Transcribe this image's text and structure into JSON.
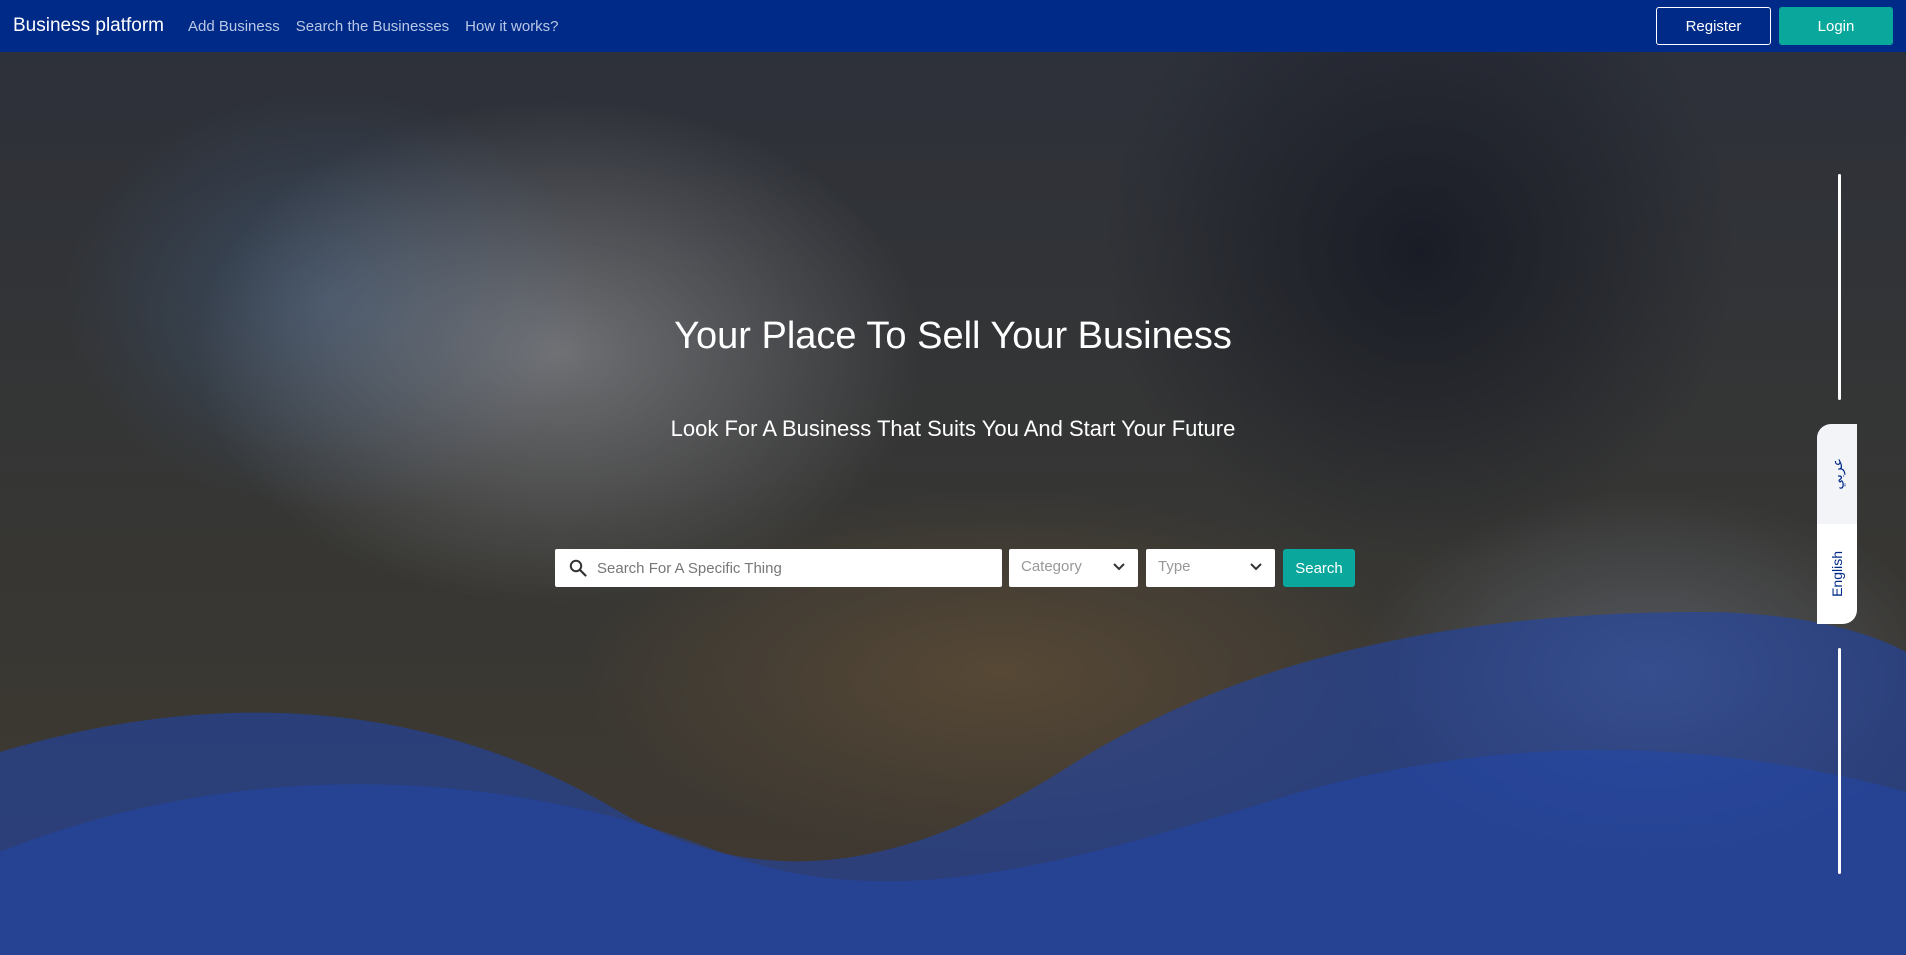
{
  "navbar": {
    "brand": "Business platform",
    "links": [
      "Add Business",
      "Search the Businesses",
      "How it works?"
    ],
    "register_label": "Register",
    "login_label": "Login"
  },
  "hero": {
    "title": "Your Place To Sell Your Business",
    "subtitle": "Look For A Business That Suits You And Start Your Future"
  },
  "search": {
    "placeholder": "Search For A Specific Thing",
    "category_label": "Category",
    "type_label": "Type",
    "button_label": "Search"
  },
  "language": {
    "arabic_label": "عربي",
    "english_label": "English"
  },
  "colors": {
    "navbar": "#002a87",
    "accent": "#0aa89c",
    "wave": "#1e46b4"
  }
}
